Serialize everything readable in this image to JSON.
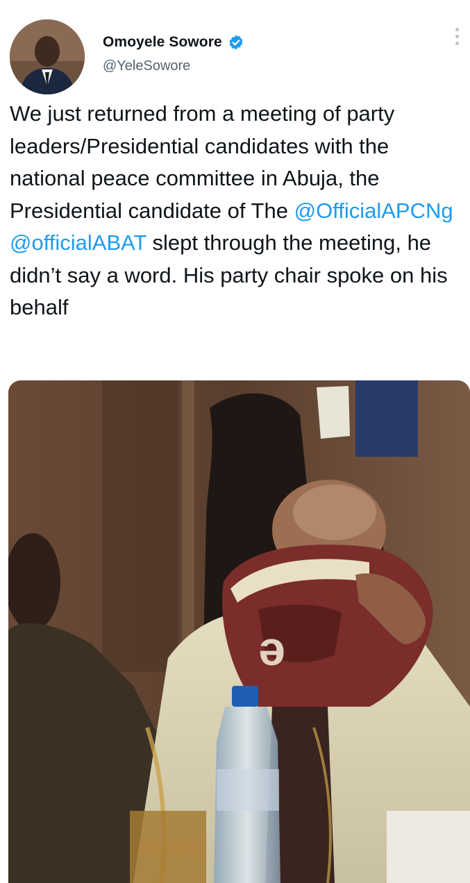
{
  "author": {
    "display_name": "Omoyele Sowore",
    "handle": "@YeleSowore",
    "verified": true,
    "avatar_icon": "profile-photo",
    "verified_icon": "verified-badge-icon",
    "verified_color": "#1d9bf0"
  },
  "menu_icon": "more-vertical-icon",
  "tweet": {
    "text_part1": "We just returned from a meeting of party leaders/Presidential candidates with the national peace committee in Abuja, the Presidential candidate of The ",
    "mention1": "@OfficialAPCNg",
    "space": " ",
    "mention2": "@officialABAT",
    "text_part2": " slept through the meeting, he didn’t say a word. His party chair spoke on his behalf"
  },
  "media": {
    "type": "photo",
    "bottle_label": "",
    "accent_colors": {
      "wall": "#6b4a35",
      "cap": "#7a2d2a",
      "robe": "#d9d2b3"
    }
  },
  "colors": {
    "text": "#0f1419",
    "secondary": "#536471",
    "link": "#1d9bf0"
  }
}
